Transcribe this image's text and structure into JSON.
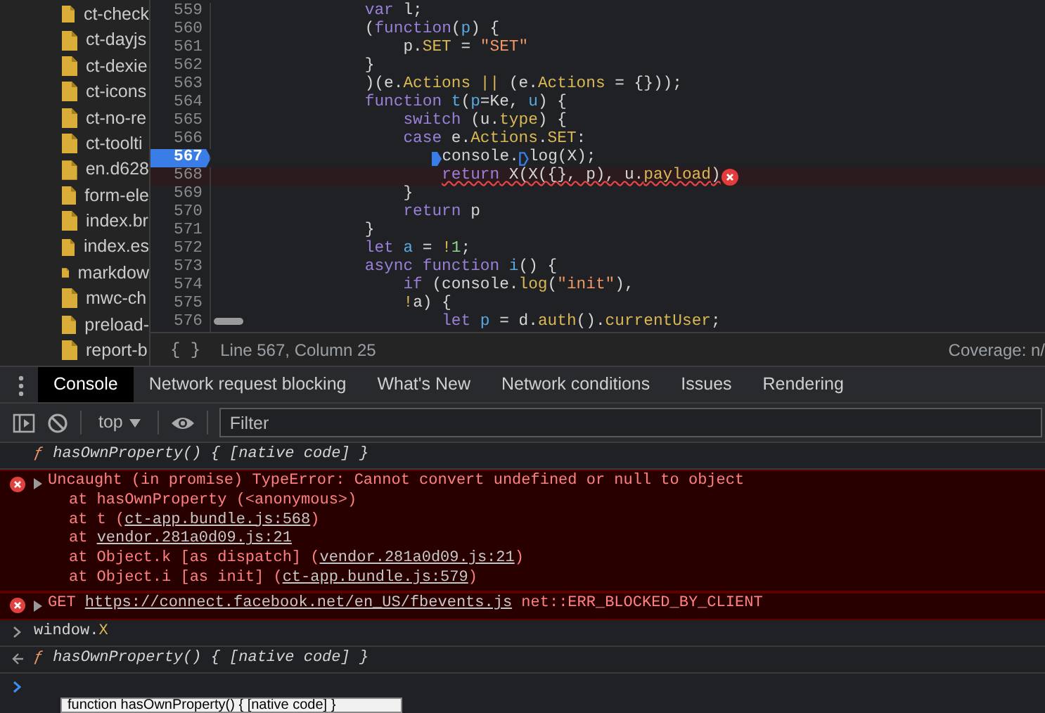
{
  "sidebar": {
    "files": [
      "ct-check",
      "ct-dayjs",
      "ct-dexie",
      "ct-icons",
      "ct-no-re",
      "ct-toolti",
      "en.d628",
      "form-ele",
      "index.br",
      "index.es",
      "markdow",
      "mwc-ch",
      "preload-",
      "report-b"
    ]
  },
  "editor": {
    "lines": [
      {
        "number": "559",
        "breakpoint": false,
        "error": false,
        "tokens": [
          {
            "kind": "keyword",
            "text": "                var"
          },
          {
            "kind": "plain",
            "text": " l;"
          }
        ]
      },
      {
        "number": "560",
        "breakpoint": false,
        "error": false,
        "tokens": [
          {
            "kind": "plain",
            "text": "                ("
          },
          {
            "kind": "keyword",
            "text": "function"
          },
          {
            "kind": "plain",
            "text": "("
          },
          {
            "kind": "def",
            "text": "p"
          },
          {
            "kind": "plain",
            "text": ") {"
          }
        ]
      },
      {
        "number": "561",
        "breakpoint": false,
        "error": false,
        "tokens": [
          {
            "kind": "plain",
            "text": "                    p."
          },
          {
            "kind": "prop",
            "text": "SET"
          },
          {
            "kind": "plain",
            "text": " = "
          },
          {
            "kind": "string",
            "text": "\"SET\""
          }
        ]
      },
      {
        "number": "562",
        "breakpoint": false,
        "error": false,
        "tokens": [
          {
            "kind": "plain",
            "text": "                }"
          }
        ]
      },
      {
        "number": "563",
        "breakpoint": false,
        "error": false,
        "tokens": [
          {
            "kind": "plain",
            "text": "                )(e."
          },
          {
            "kind": "prop",
            "text": "Actions"
          },
          {
            "kind": "prop",
            "text": " ||"
          },
          {
            "kind": "plain",
            "text": " (e."
          },
          {
            "kind": "prop",
            "text": "Actions"
          },
          {
            "kind": "plain",
            "text": " = {}));"
          }
        ]
      },
      {
        "number": "564",
        "breakpoint": false,
        "error": false,
        "tokens": [
          {
            "kind": "keyword",
            "text": "                function"
          },
          {
            "kind": "def",
            "text": " t"
          },
          {
            "kind": "plain",
            "text": "("
          },
          {
            "kind": "def",
            "text": "p"
          },
          {
            "kind": "plain",
            "text": "=Ke, "
          },
          {
            "kind": "def",
            "text": "u"
          },
          {
            "kind": "plain",
            "text": ") {"
          }
        ]
      },
      {
        "number": "565",
        "breakpoint": false,
        "error": false,
        "tokens": [
          {
            "kind": "keyword",
            "text": "                    switch"
          },
          {
            "kind": "plain",
            "text": " (u."
          },
          {
            "kind": "prop",
            "text": "type"
          },
          {
            "kind": "plain",
            "text": ") {"
          }
        ]
      },
      {
        "number": "566",
        "breakpoint": false,
        "error": false,
        "tokens": [
          {
            "kind": "keyword",
            "text": "                    case"
          },
          {
            "kind": "plain",
            "text": " e."
          },
          {
            "kind": "prop",
            "text": "Actions"
          },
          {
            "kind": "plain",
            "text": "."
          },
          {
            "kind": "prop",
            "text": "SET"
          },
          {
            "kind": "plain",
            "text": ":"
          }
        ]
      },
      {
        "number": "567",
        "breakpoint": true,
        "error": false,
        "tokens": [
          {
            "kind": "plain",
            "text": "                       console.",
            "marker": true,
            "marker_active": true
          },
          {
            "kind": "plain",
            "text": "log(X);",
            "marker": true,
            "marker_active": false
          }
        ]
      },
      {
        "number": "568",
        "breakpoint": false,
        "error": true,
        "tokens": [
          {
            "kind": "keyword",
            "text": "                        return"
          },
          {
            "kind": "plain",
            "text": " X(X({}, p), u."
          },
          {
            "kind": "prop",
            "text": "payload"
          },
          {
            "kind": "plain",
            "text": ")"
          }
        ]
      },
      {
        "number": "569",
        "breakpoint": false,
        "error": false,
        "tokens": [
          {
            "kind": "plain",
            "text": "                    }"
          }
        ]
      },
      {
        "number": "570",
        "breakpoint": false,
        "error": false,
        "tokens": [
          {
            "kind": "keyword",
            "text": "                    return"
          },
          {
            "kind": "plain",
            "text": " p"
          }
        ]
      },
      {
        "number": "571",
        "breakpoint": false,
        "error": false,
        "tokens": [
          {
            "kind": "plain",
            "text": "                }"
          }
        ]
      },
      {
        "number": "572",
        "breakpoint": false,
        "error": false,
        "tokens": [
          {
            "kind": "keyword",
            "text": "                let"
          },
          {
            "kind": "def",
            "text": " a"
          },
          {
            "kind": "plain",
            "text": " = "
          },
          {
            "kind": "prop",
            "text": "!"
          },
          {
            "kind": "number",
            "text": "1"
          },
          {
            "kind": "plain",
            "text": ";"
          }
        ]
      },
      {
        "number": "573",
        "breakpoint": false,
        "error": false,
        "tokens": [
          {
            "kind": "keyword",
            "text": "                async function"
          },
          {
            "kind": "def",
            "text": " i"
          },
          {
            "kind": "plain",
            "text": "() {"
          }
        ]
      },
      {
        "number": "574",
        "breakpoint": false,
        "error": false,
        "tokens": [
          {
            "kind": "keyword",
            "text": "                    if"
          },
          {
            "kind": "plain",
            "text": " (console."
          },
          {
            "kind": "prop",
            "text": "log"
          },
          {
            "kind": "plain",
            "text": "("
          },
          {
            "kind": "string",
            "text": "\"init\""
          },
          {
            "kind": "plain",
            "text": "),"
          }
        ]
      },
      {
        "number": "575",
        "breakpoint": false,
        "error": false,
        "tokens": [
          {
            "kind": "prop",
            "text": "                    !"
          },
          {
            "kind": "plain",
            "text": "a) {"
          }
        ]
      },
      {
        "number": "576",
        "breakpoint": false,
        "error": false,
        "tokens": [
          {
            "kind": "keyword",
            "text": "                        let"
          },
          {
            "kind": "def",
            "text": " p"
          },
          {
            "kind": "plain",
            "text": " = d."
          },
          {
            "kind": "prop",
            "text": "auth"
          },
          {
            "kind": "plain",
            "text": "()."
          },
          {
            "kind": "prop",
            "text": "currentUser"
          },
          {
            "kind": "plain",
            "text": ";"
          }
        ]
      }
    ]
  },
  "status_bar": {
    "format_button": "{ }",
    "position": "Line 567, Column 25",
    "coverage": "Coverage: n/"
  },
  "panel_tabs": [
    {
      "label": "Console",
      "selected": true
    },
    {
      "label": "Network request blocking",
      "selected": false
    },
    {
      "label": "What's New",
      "selected": false
    },
    {
      "label": "Network conditions",
      "selected": false
    },
    {
      "label": "Issues",
      "selected": false
    },
    {
      "label": "Rendering",
      "selected": false
    }
  ],
  "toolbar": {
    "context": "top",
    "filter_placeholder": "Filter"
  },
  "console": {
    "messages": [
      {
        "kind": "result",
        "prefix": "ƒ",
        "segments": [
          {
            "kind": "plain",
            "text": "hasOwnProperty() { [native code] }"
          }
        ]
      },
      {
        "kind": "error",
        "expanded": false,
        "lines": [
          [
            {
              "kind": "plain",
              "text": "Uncaught (in promise) TypeError: Cannot convert undefined or null to object"
            }
          ],
          [
            {
              "kind": "plain",
              "text": "at hasOwnProperty (<anonymous>)"
            }
          ],
          [
            {
              "kind": "plain",
              "text": "at t ("
            },
            {
              "kind": "link",
              "text": "ct-app.bundle.js:568"
            },
            {
              "kind": "plain",
              "text": ")"
            }
          ],
          [
            {
              "kind": "plain",
              "text": "at "
            },
            {
              "kind": "link",
              "text": "vendor.281a0d09.js:21"
            }
          ],
          [
            {
              "kind": "plain",
              "text": "at Object.k [as dispatch] ("
            },
            {
              "kind": "link",
              "text": "vendor.281a0d09.js:21"
            },
            {
              "kind": "plain",
              "text": ")"
            }
          ],
          [
            {
              "kind": "plain",
              "text": "at Object.i [as init] ("
            },
            {
              "kind": "link",
              "text": "ct-app.bundle.js:579"
            },
            {
              "kind": "plain",
              "text": ")"
            }
          ]
        ]
      },
      {
        "kind": "error",
        "expanded": false,
        "lines": [
          [
            {
              "kind": "plain",
              "text": "GET "
            },
            {
              "kind": "link",
              "text": "https://connect.facebook.net/en_US/fbevents.js"
            },
            {
              "kind": "plain",
              "text": " net::ERR_BLOCKED_BY_CLIENT"
            }
          ]
        ]
      },
      {
        "kind": "input",
        "segments": [
          {
            "kind": "plain",
            "text": "window."
          },
          {
            "kind": "prop",
            "text": "X"
          }
        ]
      },
      {
        "kind": "output",
        "prefix": "ƒ",
        "segments": [
          {
            "kind": "plain",
            "text": "hasOwnProperty() { [native code] }"
          }
        ]
      }
    ],
    "autocomplete_hint": "function hasOwnProperty() { [native code] }"
  }
}
